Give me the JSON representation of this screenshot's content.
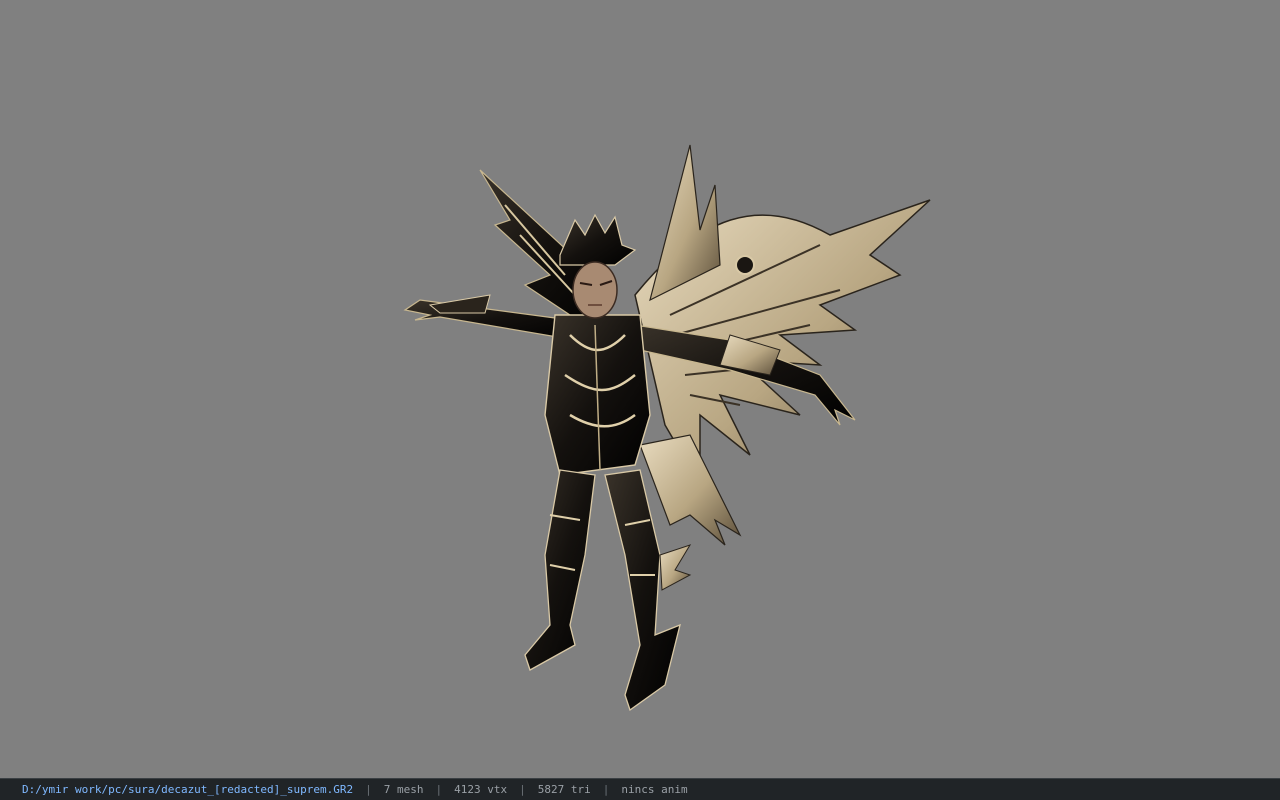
{
  "viewport": {
    "background": "#808080",
    "model_icon": "armored-winged-character-model"
  },
  "statusbar": {
    "path": "D:/ymir work/pc/sura/decazut_[redacted]_suprem.GR2",
    "mesh": "7 mesh",
    "vtx": "4123 vtx",
    "tri": "5827 tri",
    "anim": "nincs anim",
    "separator": "|",
    "path_color": "#7fb8ff",
    "text_color": "#9aa0a6"
  }
}
